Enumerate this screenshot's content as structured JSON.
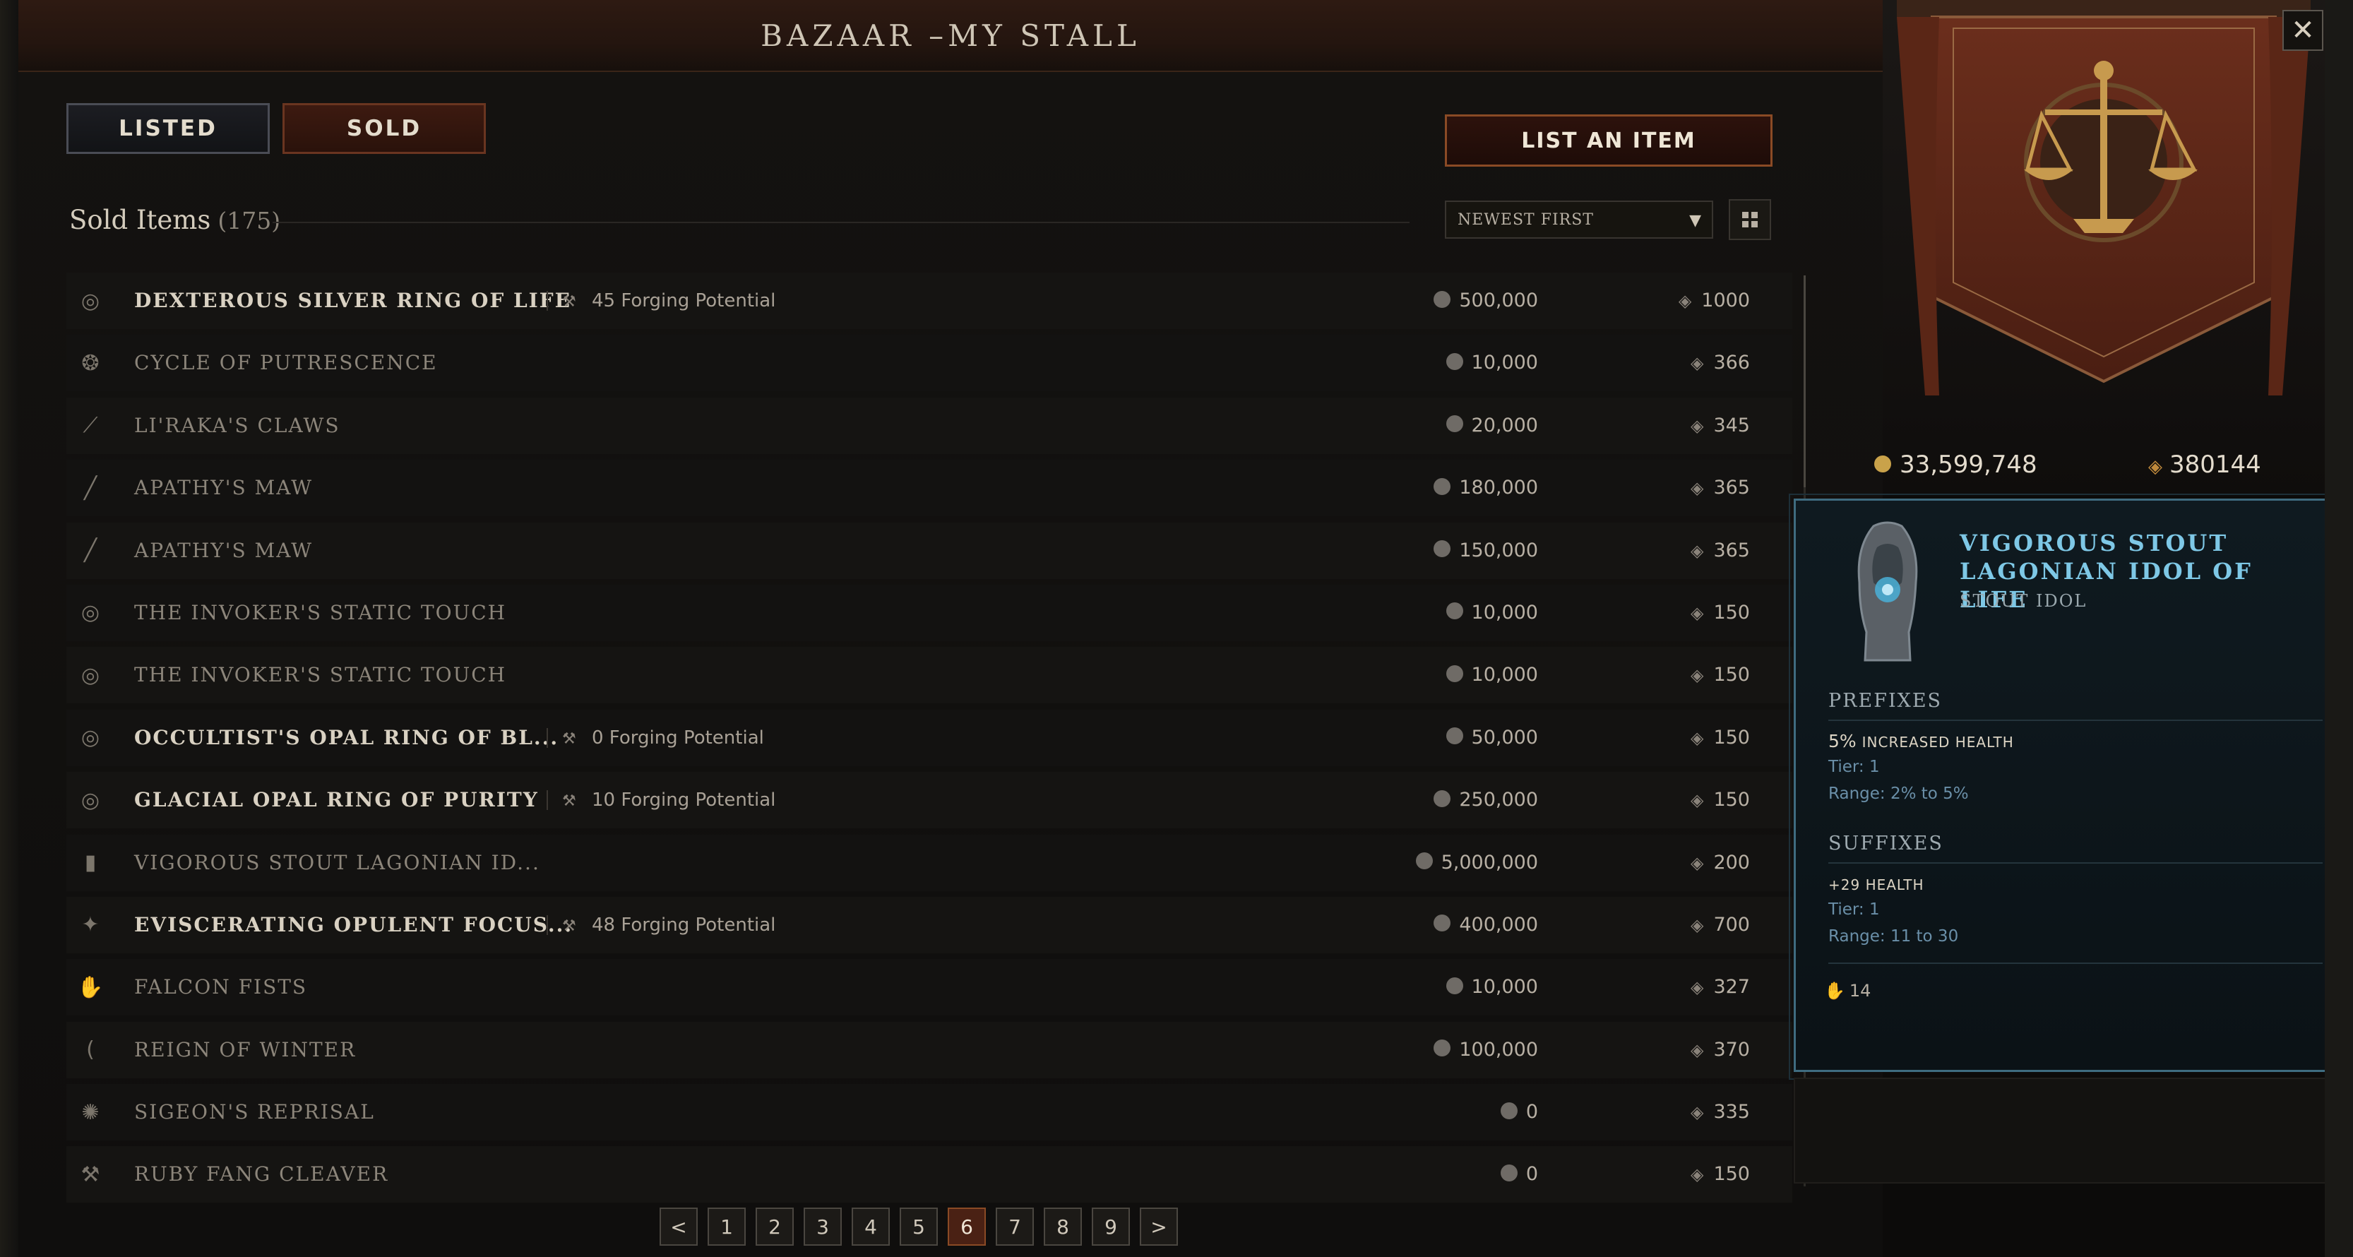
{
  "window": {
    "title": "BAZAAR –MY STALL"
  },
  "tabs": {
    "listed": "LISTED",
    "sold": "SOLD"
  },
  "actions": {
    "list_item": "LIST AN ITEM"
  },
  "sold": {
    "label": "Sold Items",
    "count": "(175)"
  },
  "sort": {
    "value": "NEWEST FIRST"
  },
  "colors": {
    "accent": "#8a4a25",
    "tooltip_border": "#3f6c80",
    "item_name_blue": "#7ec8e6"
  },
  "items": [
    {
      "name": "DEXTEROUS SILVER RING OF LIFE",
      "forging": "45 Forging Potential",
      "price": "500,000",
      "favor": "1000",
      "icon": "ring-icon",
      "highlight": true
    },
    {
      "name": "CYCLE OF PUTRESCENCE",
      "forging": "",
      "price": "10,000",
      "favor": "366",
      "icon": "amulet-icon",
      "highlight": false
    },
    {
      "name": "LI'RAKA'S CLAWS",
      "forging": "",
      "price": "20,000",
      "favor": "345",
      "icon": "claw-icon",
      "highlight": false
    },
    {
      "name": "APATHY'S MAW",
      "forging": "",
      "price": "180,000",
      "favor": "365",
      "icon": "staff-icon",
      "highlight": false
    },
    {
      "name": "APATHY'S MAW",
      "forging": "",
      "price": "150,000",
      "favor": "365",
      "icon": "staff-icon",
      "highlight": false
    },
    {
      "name": "THE INVOKER'S STATIC TOUCH",
      "forging": "",
      "price": "10,000",
      "favor": "150",
      "icon": "ring-icon",
      "highlight": false
    },
    {
      "name": "THE INVOKER'S STATIC TOUCH",
      "forging": "",
      "price": "10,000",
      "favor": "150",
      "icon": "ring-icon",
      "highlight": false
    },
    {
      "name": "OCCULTIST'S OPAL RING OF BL...",
      "forging": "0 Forging Potential",
      "price": "50,000",
      "favor": "150",
      "icon": "ring-icon",
      "highlight": true
    },
    {
      "name": "GLACIAL OPAL RING OF PURITY",
      "forging": "10 Forging Potential",
      "price": "250,000",
      "favor": "150",
      "icon": "ring-icon",
      "highlight": true
    },
    {
      "name": "VIGOROUS STOUT LAGONIAN ID...",
      "forging": "",
      "price": "5,000,000",
      "favor": "200",
      "icon": "idol-icon",
      "highlight": false
    },
    {
      "name": "EVISCERATING OPULENT FOCUS...",
      "forging": "48 Forging Potential",
      "price": "400,000",
      "favor": "700",
      "icon": "focus-icon",
      "highlight": true
    },
    {
      "name": "FALCON FISTS",
      "forging": "",
      "price": "10,000",
      "favor": "327",
      "icon": "gloves-icon",
      "highlight": false
    },
    {
      "name": "REIGN OF WINTER",
      "forging": "",
      "price": "100,000",
      "favor": "370",
      "icon": "bow-icon",
      "highlight": false
    },
    {
      "name": "SIGEON'S REPRISAL",
      "forging": "",
      "price": "0",
      "favor": "335",
      "icon": "shield-icon",
      "highlight": false
    },
    {
      "name": "RUBY FANG CLEAVER",
      "forging": "",
      "price": "0",
      "favor": "150",
      "icon": "axe-icon",
      "highlight": false
    }
  ],
  "pager": {
    "prev": "<",
    "next": ">",
    "pages": [
      "1",
      "2",
      "3",
      "4",
      "5",
      "6",
      "7",
      "8",
      "9"
    ],
    "current": "6"
  },
  "balance": {
    "gold": "33,599,748",
    "favor": "380144"
  },
  "tooltip": {
    "name": "VIGOROUS STOUT LAGONIAN IDOL OF LIFE",
    "type": "STOUT IDOL",
    "prefixes_label": "PREFIXES",
    "prefix": {
      "value": "5%",
      "text": "INCREASED HEALTH",
      "tier": "Tier: 1",
      "range": "Range: 2% to 5%"
    },
    "suffixes_label": "SUFFIXES",
    "suffix": {
      "value": "+29 HEALTH",
      "tier": "Tier: 1",
      "range": "Range: 11 to 30"
    },
    "legendary_potential": "14"
  }
}
